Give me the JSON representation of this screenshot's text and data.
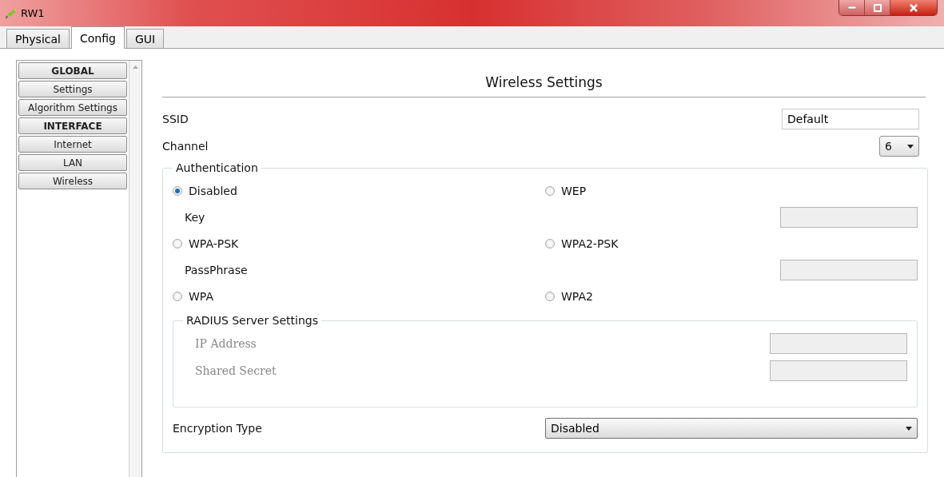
{
  "window": {
    "title": "RW1"
  },
  "tabs": [
    {
      "label": "Physical",
      "selected": false
    },
    {
      "label": "Config",
      "selected": true
    },
    {
      "label": "GUI",
      "selected": false
    }
  ],
  "sidebar": {
    "items": [
      {
        "label": "GLOBAL",
        "kind": "header"
      },
      {
        "label": "Settings",
        "kind": "item"
      },
      {
        "label": "Algorithm Settings",
        "kind": "item"
      },
      {
        "label": "INTERFACE",
        "kind": "header"
      },
      {
        "label": "Internet",
        "kind": "item"
      },
      {
        "label": "LAN",
        "kind": "item"
      },
      {
        "label": "Wireless",
        "kind": "item"
      }
    ]
  },
  "panel": {
    "title": "Wireless Settings",
    "ssid": {
      "label": "SSID",
      "value": "Default"
    },
    "channel": {
      "label": "Channel",
      "value": "6"
    },
    "authentication": {
      "legend": "Authentication",
      "rows": [
        {
          "kind": "radios",
          "options": [
            {
              "label": "Disabled",
              "selected": true
            },
            {
              "label": "WEP",
              "selected": false
            }
          ]
        },
        {
          "kind": "field",
          "label": "Key",
          "disabled": true
        },
        {
          "kind": "radios",
          "options": [
            {
              "label": "WPA-PSK",
              "selected": false
            },
            {
              "label": "WPA2-PSK",
              "selected": false
            }
          ]
        },
        {
          "kind": "field",
          "label": "PassPhrase",
          "disabled": true
        },
        {
          "kind": "radios",
          "options": [
            {
              "label": "WPA",
              "selected": false
            },
            {
              "label": "WPA2",
              "selected": false
            }
          ]
        }
      ],
      "radius": {
        "legend": "RADIUS Server Settings",
        "disabled": true,
        "fields": [
          {
            "label": "IP Address"
          },
          {
            "label": "Shared Secret"
          }
        ]
      },
      "encryption": {
        "label": "Encryption Type",
        "value": "Disabled"
      }
    }
  }
}
